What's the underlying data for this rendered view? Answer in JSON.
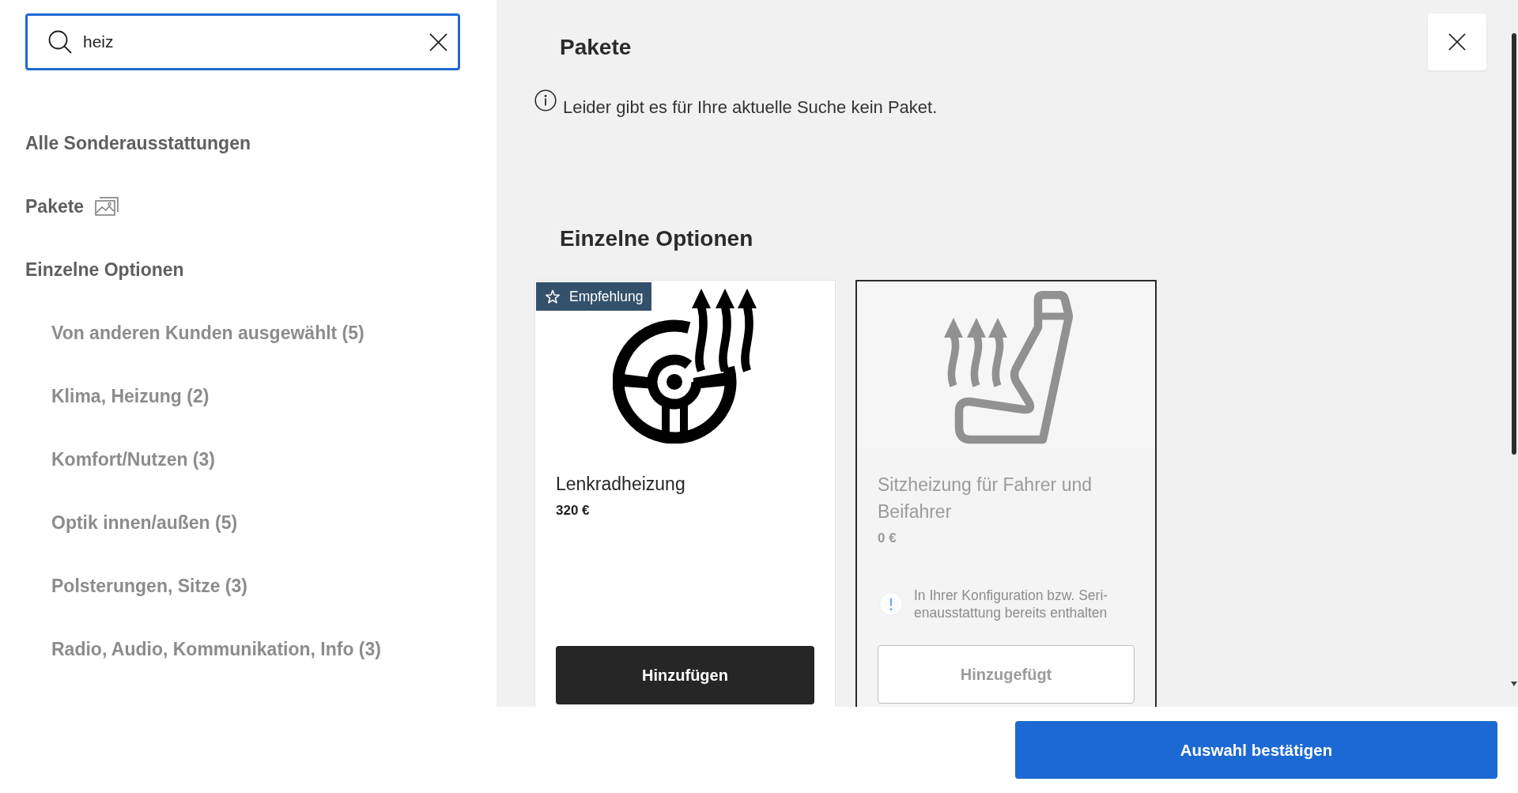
{
  "search": {
    "value": "heiz"
  },
  "sidebar": {
    "items": [
      {
        "label": "Alle Sonderausstattungen",
        "kind": "plain"
      },
      {
        "label": "Pakete",
        "kind": "gallery"
      },
      {
        "label": "Einzelne Optionen",
        "kind": "plain",
        "children": [
          {
            "label": "Von anderen Kunden ausgewählt (5)"
          },
          {
            "label": "Klima, Heizung (2)"
          },
          {
            "label": "Komfort/Nutzen (3)"
          },
          {
            "label": "Optik innen/außen (5)"
          },
          {
            "label": "Polsterungen, Sitze (3)"
          },
          {
            "label": "Radio, Audio, Kommunikation, Info (3)"
          }
        ]
      }
    ]
  },
  "packages": {
    "title": "Pakete",
    "message": "Leider gibt es für Ihre aktuelle Suche kein Paket."
  },
  "options": {
    "title": "Einzelne Optionen",
    "cards": [
      {
        "badge": "Empfehlung",
        "title": "Lenkradheizung",
        "price": "320 €",
        "button": "Hinzufügen",
        "added": false
      },
      {
        "title": "Sitzheizung für Fahrer und Beifahrer",
        "price": "0 €",
        "note": "In Ihrer Konfiguration bzw. Seri-enausstattung bereits enthalten",
        "button": "Hinzugefügt",
        "added": true
      }
    ]
  },
  "footer": {
    "confirm_button": "Auswahl bestätigen"
  }
}
